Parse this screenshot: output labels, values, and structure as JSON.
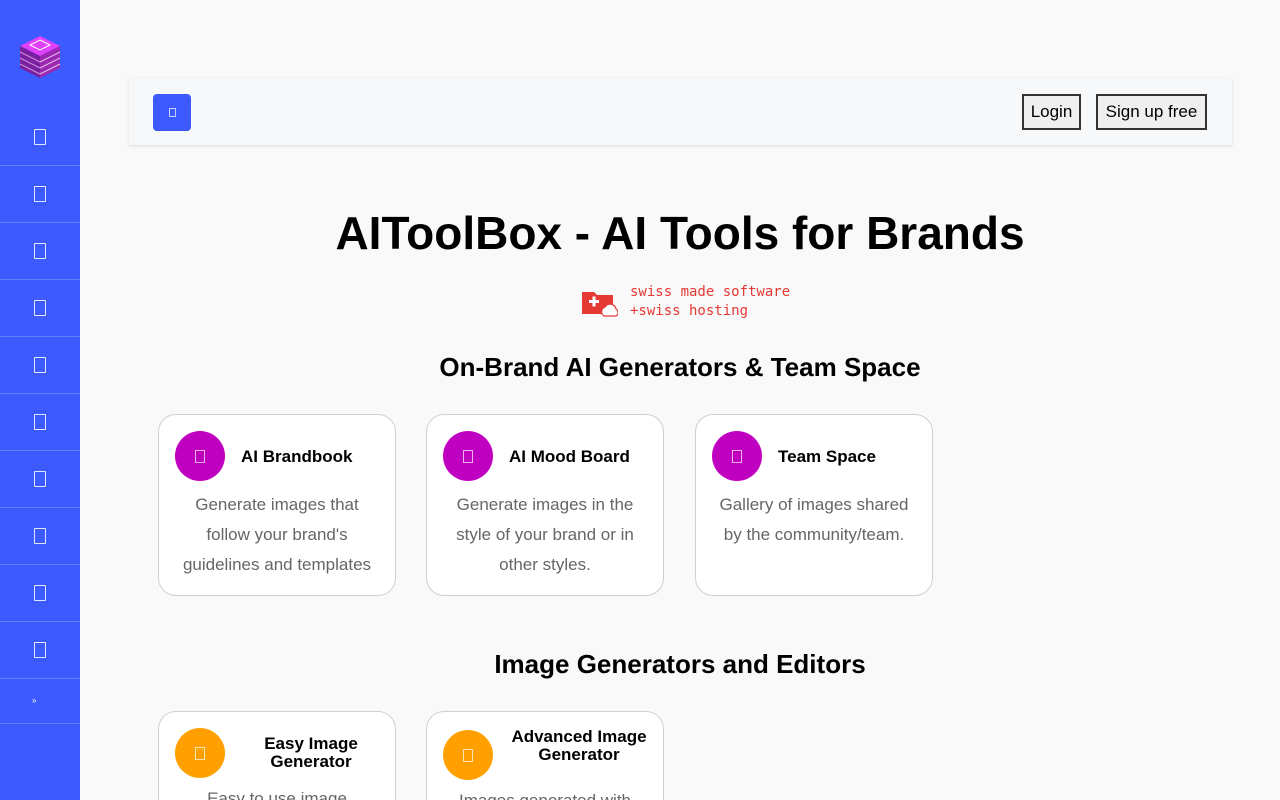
{
  "sidebar": {
    "items": [
      "home-icon",
      "brandbook-icon",
      "moodboard-icon",
      "team-icon",
      "image-icon",
      "editor-icon",
      "video-icon",
      "text-icon",
      "settings-icon",
      "help-icon"
    ],
    "collapse_glyph": "»"
  },
  "header": {
    "login": "Login",
    "signup": "Sign up free"
  },
  "main": {
    "title": "AIToolBox - AI Tools for Brands",
    "swiss_line1": "swiss made software",
    "swiss_line2": "+swiss hosting",
    "section1": {
      "title": "On-Brand AI Generators & Team Space",
      "cards": [
        {
          "title": "AI Brandbook",
          "desc": "Generate images that follow your brand's guidelines and templates"
        },
        {
          "title": "AI Mood Board",
          "desc": "Generate images in the style of your brand or in other styles."
        },
        {
          "title": "Team Space",
          "desc": "Gallery of images shared by the community/team."
        }
      ]
    },
    "section2": {
      "title": "Image Generators and Editors",
      "cards": [
        {
          "title": "Easy Image Generator",
          "desc": "Easy to use image"
        },
        {
          "title": "Advanced Image Generator",
          "desc": "Images generated with"
        }
      ]
    }
  },
  "colors": {
    "accent": "#3d5afe",
    "magenta": "#c000c0",
    "orange": "#ffa000",
    "swiss_red": "#e53935"
  }
}
